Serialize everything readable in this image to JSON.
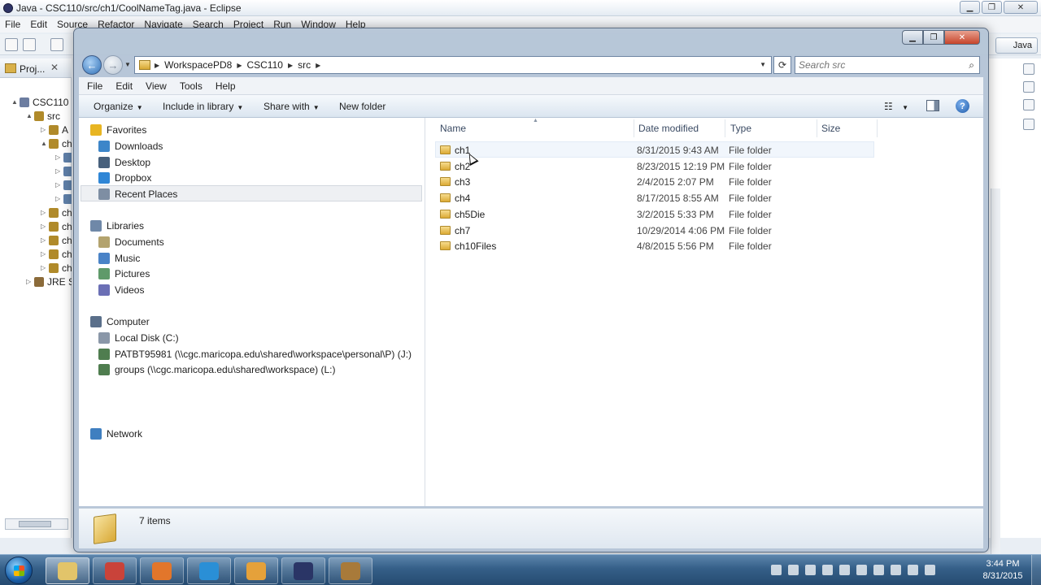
{
  "eclipse": {
    "title": "Java - CSC110/src/ch1/CoolNameTag.java - Eclipse",
    "menu": [
      "File",
      "Edit",
      "Source",
      "Refactor",
      "Navigate",
      "Search",
      "Project",
      "Run",
      "Window",
      "Help"
    ],
    "perspective": "Java",
    "project_tab": "Proj...",
    "tree": [
      {
        "label": "CSC110",
        "indent": 0,
        "exp": "▲",
        "icon": "project"
      },
      {
        "label": "src",
        "indent": 1,
        "exp": "▲",
        "icon": "package"
      },
      {
        "label": "A",
        "indent": 2,
        "exp": "▷",
        "icon": "package"
      },
      {
        "label": "ch",
        "indent": 2,
        "exp": "▲",
        "icon": "package"
      },
      {
        "label": "",
        "indent": 3,
        "exp": "▷",
        "icon": "file"
      },
      {
        "label": "",
        "indent": 3,
        "exp": "▷",
        "icon": "file"
      },
      {
        "label": "",
        "indent": 3,
        "exp": "▷",
        "icon": "file"
      },
      {
        "label": "",
        "indent": 3,
        "exp": "▷",
        "icon": "file"
      },
      {
        "label": "ch",
        "indent": 2,
        "exp": "▷",
        "icon": "package"
      },
      {
        "label": "ch",
        "indent": 2,
        "exp": "▷",
        "icon": "package"
      },
      {
        "label": "ch",
        "indent": 2,
        "exp": "▷",
        "icon": "package"
      },
      {
        "label": "ch",
        "indent": 2,
        "exp": "▷",
        "icon": "package"
      },
      {
        "label": "ch",
        "indent": 2,
        "exp": "▷",
        "icon": "package"
      },
      {
        "label": "JRE S",
        "indent": 1,
        "exp": "▷",
        "icon": "library"
      }
    ]
  },
  "explorer": {
    "breadcrumbs": [
      "WorkspacePD8",
      "CSC110",
      "src"
    ],
    "search_placeholder": "Search src",
    "menu": [
      "File",
      "Edit",
      "View",
      "Tools",
      "Help"
    ],
    "commands": {
      "organize": "Organize",
      "include_in_library": "Include in library",
      "share_with": "Share with",
      "new_folder": "New folder"
    },
    "nav_pane": {
      "favorites": {
        "label": "Favorites",
        "items": [
          "Downloads",
          "Desktop",
          "Dropbox",
          "Recent Places"
        ]
      },
      "libraries": {
        "label": "Libraries",
        "items": [
          "Documents",
          "Music",
          "Pictures",
          "Videos"
        ]
      },
      "computer": {
        "label": "Computer",
        "items": [
          "Local Disk (C:)",
          "PATBT95981 (\\\\cgc.maricopa.edu\\shared\\workspace\\personal\\P) (J:)",
          "groups (\\\\cgc.maricopa.edu\\shared\\workspace) (L:)"
        ]
      },
      "network": {
        "label": "Network"
      }
    },
    "columns": [
      "Name",
      "Date modified",
      "Type",
      "Size"
    ],
    "files": [
      {
        "name": "ch1",
        "date": "8/31/2015 9:43 AM",
        "type": "File folder"
      },
      {
        "name": "ch2",
        "date": "8/23/2015 12:19 PM",
        "type": "File folder"
      },
      {
        "name": "ch3",
        "date": "2/4/2015 2:07 PM",
        "type": "File folder"
      },
      {
        "name": "ch4",
        "date": "8/17/2015 8:55 AM",
        "type": "File folder"
      },
      {
        "name": "ch5Die",
        "date": "3/2/2015 5:33 PM",
        "type": "File folder"
      },
      {
        "name": "ch7",
        "date": "10/29/2014 4:06 PM",
        "type": "File folder"
      },
      {
        "name": "ch10Files",
        "date": "4/8/2015 5:56 PM",
        "type": "File folder"
      }
    ],
    "status_count": "7 items"
  },
  "taskbar": {
    "time": "3:44 PM",
    "date": "8/31/2015",
    "apps": [
      "explorer",
      "coolit",
      "firefox",
      "internet-explorer",
      "media-player",
      "eclipse",
      "java-tool"
    ]
  },
  "colors": {
    "folder": "#dcab35",
    "taskbar": "#355f88",
    "explorer_frame": "#b4c4d6",
    "selection": "#eef0f3"
  }
}
